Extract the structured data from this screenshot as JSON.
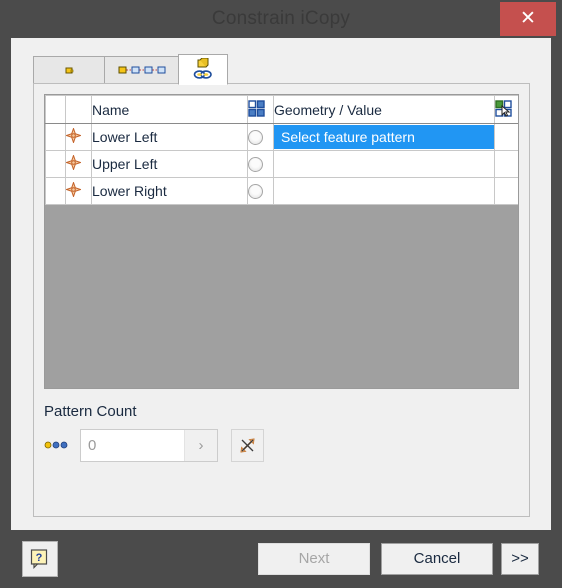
{
  "window": {
    "title": "Constrain iCopy",
    "close_label": "✕",
    "close_icon": "close-icon",
    "titlebar_color": "#4b4b4b",
    "close_color": "#c5504e"
  },
  "tabs": [
    {
      "id": "tab-0",
      "icon": "single-component-icon",
      "label": "",
      "active": false
    },
    {
      "id": "tab-1",
      "icon": "component-chain-icon",
      "label": "",
      "active": false
    },
    {
      "id": "tab-2",
      "icon": "pattern-constrain-icon",
      "label": "",
      "active": true
    }
  ],
  "grid": {
    "headers": {
      "select": "",
      "icon": "",
      "name": "Name",
      "pick_icon": "pattern-grid-icon",
      "geometry": "Geometry / Value",
      "last_icon": "pattern-pick-grid-icon"
    },
    "rows": [
      {
        "icon": "constraint-point-icon",
        "name": "Lower Left",
        "picker": "radio-unselected",
        "geometry": "Select feature pattern",
        "geometry_selected": true
      },
      {
        "icon": "constraint-point-icon",
        "name": "Upper Left",
        "picker": "radio-unselected",
        "geometry": "",
        "geometry_selected": false
      },
      {
        "icon": "constraint-point-icon",
        "name": "Lower Right",
        "picker": "radio-unselected",
        "geometry": "",
        "geometry_selected": false
      }
    ],
    "selection_color": "#2196f3",
    "empty_area_color": "#a0a0a0"
  },
  "pattern_count": {
    "label": "Pattern Count",
    "dots_icon": "three-dots-icon",
    "value": "0",
    "placeholder": "0",
    "dropdown_glyph": "›",
    "flip_icon": "flip-direction-icon"
  },
  "footer": {
    "help_icon": "help-question-icon",
    "next_label": "Next",
    "cancel_label": "Cancel",
    "more_label": ">>"
  }
}
